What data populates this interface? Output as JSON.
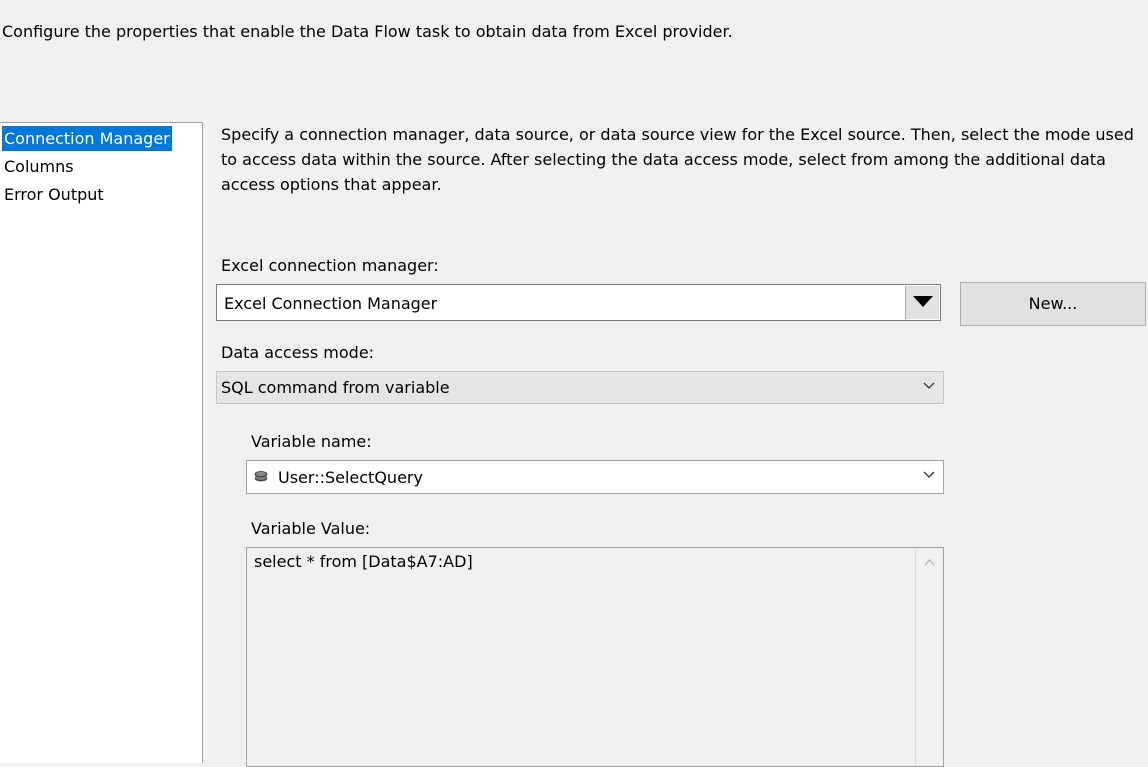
{
  "header": {
    "description": "Configure the properties that enable the Data Flow task to obtain data from Excel provider."
  },
  "nav": {
    "items": [
      {
        "label": "Connection Manager",
        "selected": true
      },
      {
        "label": "Columns",
        "selected": false
      },
      {
        "label": "Error Output",
        "selected": false
      }
    ]
  },
  "main": {
    "instructions": "Specify a connection manager, data source, or data source view for the Excel source. Then, select the mode used to access data within the source. After selecting the data access mode, select from among the additional data access options that appear.",
    "connection_manager": {
      "label": "Excel connection manager:",
      "value": "Excel Connection Manager",
      "new_button": "New..."
    },
    "access_mode": {
      "label": "Data access mode:",
      "value": "SQL command from variable"
    },
    "variable_name": {
      "label": "Variable name:",
      "value": "User::SelectQuery",
      "icon": "variable-icon"
    },
    "variable_value": {
      "label": "Variable Value:",
      "value": "select * from [Data$A7:AD]"
    }
  },
  "colors": {
    "selection": "#0078d7",
    "background": "#f0f0f0"
  }
}
